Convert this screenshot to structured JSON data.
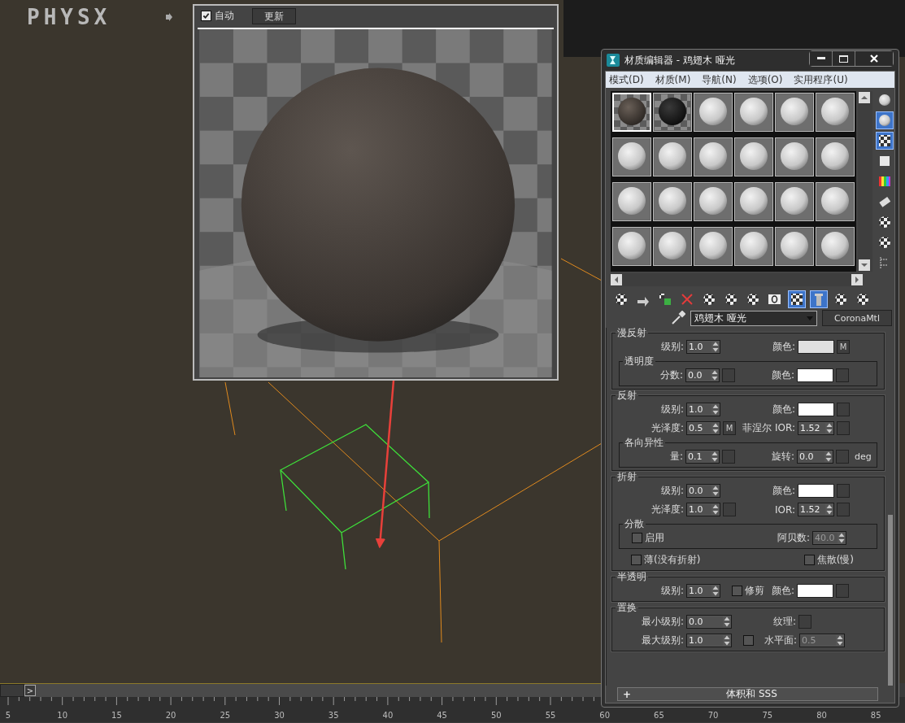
{
  "viewport": {
    "logo": "PHYSX"
  },
  "preview_window": {
    "auto_label": "自动",
    "auto_checked": true,
    "update_button": "更新"
  },
  "material_editor": {
    "title": "材质编辑器 - 鸡翅木 哑光",
    "menu": [
      "模式(D)",
      "材质(M)",
      "导航(N)",
      "选项(O)",
      "实用程序(U)"
    ],
    "slots": [
      {
        "kind": "wood",
        "selected": true
      },
      {
        "kind": "glossy",
        "selected": false
      },
      {
        "kind": "default",
        "selected": false
      },
      {
        "kind": "default",
        "selected": false
      },
      {
        "kind": "default",
        "selected": false
      },
      {
        "kind": "default",
        "selected": false
      },
      {
        "kind": "default",
        "selected": false
      },
      {
        "kind": "default",
        "selected": false
      },
      {
        "kind": "default",
        "selected": false
      },
      {
        "kind": "default",
        "selected": false
      },
      {
        "kind": "default",
        "selected": false
      },
      {
        "kind": "default",
        "selected": false
      },
      {
        "kind": "default",
        "selected": false
      },
      {
        "kind": "default",
        "selected": false
      },
      {
        "kind": "default",
        "selected": false
      },
      {
        "kind": "default",
        "selected": false
      },
      {
        "kind": "default",
        "selected": false
      },
      {
        "kind": "default",
        "selected": false
      },
      {
        "kind": "default",
        "selected": false
      },
      {
        "kind": "default",
        "selected": false
      },
      {
        "kind": "default",
        "selected": false
      },
      {
        "kind": "default",
        "selected": false
      },
      {
        "kind": "default",
        "selected": false
      },
      {
        "kind": "default",
        "selected": false
      }
    ],
    "side_tools": [
      {
        "kind": "sphere",
        "selected": false
      },
      {
        "kind": "backlight",
        "selected": true
      },
      {
        "kind": "checker",
        "selected": true
      },
      {
        "kind": "sample",
        "selected": false
      },
      {
        "kind": "color-check",
        "selected": false
      },
      {
        "kind": "video",
        "selected": false
      },
      {
        "kind": "options",
        "selected": false
      },
      {
        "kind": "select",
        "selected": false
      },
      {
        "kind": "navigator",
        "selected": false
      }
    ],
    "toolbar": [
      {
        "kind": "get",
        "selected": false
      },
      {
        "kind": "put",
        "selected": false
      },
      {
        "kind": "assign",
        "selected": false
      },
      {
        "kind": "delete",
        "selected": false
      },
      {
        "kind": "copy",
        "selected": false
      },
      {
        "kind": "unique",
        "selected": false
      },
      {
        "kind": "library",
        "selected": false
      },
      {
        "kind": "id",
        "selected": false
      },
      {
        "kind": "show-map",
        "selected": true
      },
      {
        "kind": "show-end",
        "selected": true
      },
      {
        "kind": "parent",
        "selected": false
      },
      {
        "kind": "sibling",
        "selected": false
      }
    ],
    "material_name": "鸡翅木 哑光",
    "type_button": "CoronaMtl",
    "diffuse": {
      "title": "漫反射",
      "level_label": "级别:",
      "level": "1.0",
      "color_label": "颜色:",
      "color": "#e0e0e0",
      "map_button": "M",
      "translucency": {
        "title": "透明度",
        "fraction_label": "分数:",
        "fraction": "0.0",
        "color_label": "颜色:",
        "color": "#ffffff"
      }
    },
    "reflection": {
      "title": "反射",
      "level_label": "级别:",
      "level": "1.0",
      "color_label": "颜色:",
      "color": "#ffffff",
      "gloss_label": "光泽度:",
      "gloss": "0.5",
      "gloss_map_button": "M",
      "fresnel_label": "菲涅尔 IOR:",
      "fresnel": "1.52",
      "anisotropy": {
        "title": "各向异性",
        "amount_label": "量:",
        "amount": "0.1",
        "rotation_label": "旋转:",
        "rotation": "0.0",
        "unit": "deg"
      }
    },
    "refraction": {
      "title": "折射",
      "level_label": "级别:",
      "level": "0.0",
      "color_label": "颜色:",
      "color": "#ffffff",
      "gloss_label": "光泽度:",
      "gloss": "1.0",
      "ior_label": "IOR:",
      "ior": "1.52",
      "dispersion": {
        "title": "分散",
        "enable_label": "启用",
        "enabled": false,
        "abbe_label": "阿贝数:",
        "abbe": {
          "value": "40.0",
          "disabled": true
        }
      },
      "thin": {
        "label": "薄(没有折射)",
        "checked": false
      },
      "caustics": {
        "label": "焦散(慢)",
        "checked": false
      }
    },
    "translucency": {
      "title": "半透明",
      "level_label": "级别:",
      "level": "1.0",
      "clip_label": "修剪",
      "clip": false,
      "color_label": "颜色:",
      "color": "#ffffff"
    },
    "displacement": {
      "title": "置换",
      "min_label": "最小级别:",
      "min": "0.0",
      "texture_label": "纹理:",
      "max_label": "最大级别:",
      "max": "1.0",
      "water_label": "水平面:",
      "water_enabled": false,
      "water": {
        "value": "0.5",
        "disabled": true
      }
    },
    "rollout": {
      "sign": "+",
      "title": "体积和 SSS"
    }
  },
  "timeline": {
    "next_button": ">",
    "ticks": [
      "5",
      "10",
      "15",
      "20",
      "25",
      "30",
      "35",
      "40",
      "45",
      "50",
      "55",
      "60",
      "65",
      "70",
      "75",
      "80",
      "85"
    ]
  }
}
